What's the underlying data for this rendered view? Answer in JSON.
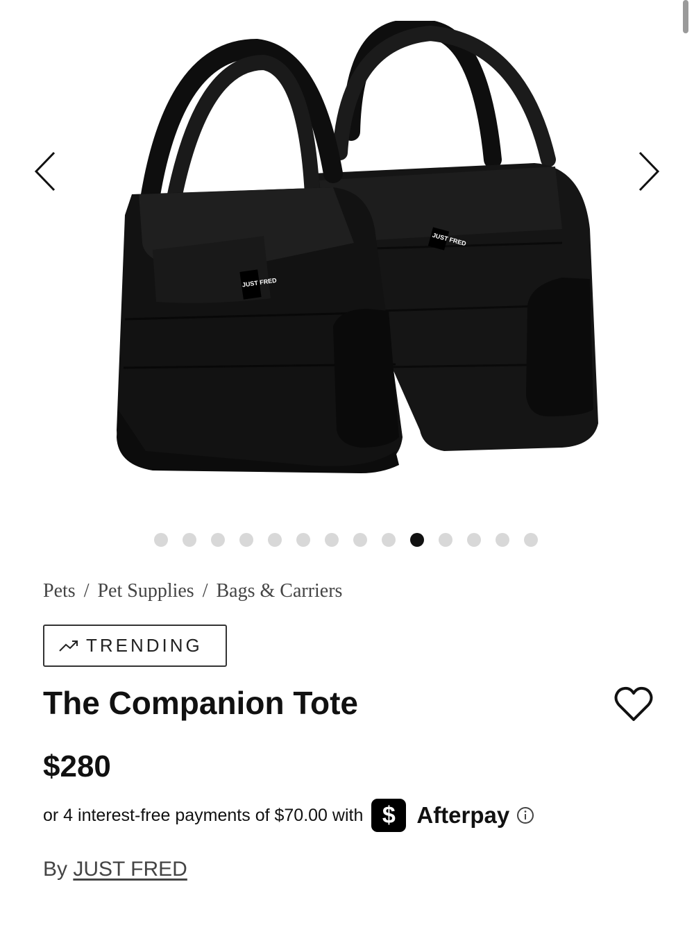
{
  "gallery": {
    "image_alt": "Two black quilted pet carrier tote bags",
    "tag_text": "JUST FRED",
    "prev_icon": "chevron-left-icon",
    "next_icon": "chevron-right-icon",
    "total_images": 14,
    "active_index": 9
  },
  "breadcrumb": {
    "items": [
      "Pets",
      "Pet Supplies",
      "Bags & Carriers"
    ],
    "separator": "/"
  },
  "badge": {
    "label": "TRENDING",
    "icon": "trend-up-icon"
  },
  "product": {
    "title": "The Companion Tote",
    "price": "$280",
    "wishlist_icon": "heart-icon"
  },
  "afterpay": {
    "text": "or 4 interest-free payments of $70.00 with",
    "badge_symbol": "$",
    "brand": "Afterpay",
    "info_icon": "info-icon"
  },
  "byline": {
    "prefix": "By ",
    "brand": "JUST FRED"
  },
  "colors": {
    "accent": "#111111",
    "dot_inactive": "#d8d8d8",
    "bag": "#141414"
  }
}
